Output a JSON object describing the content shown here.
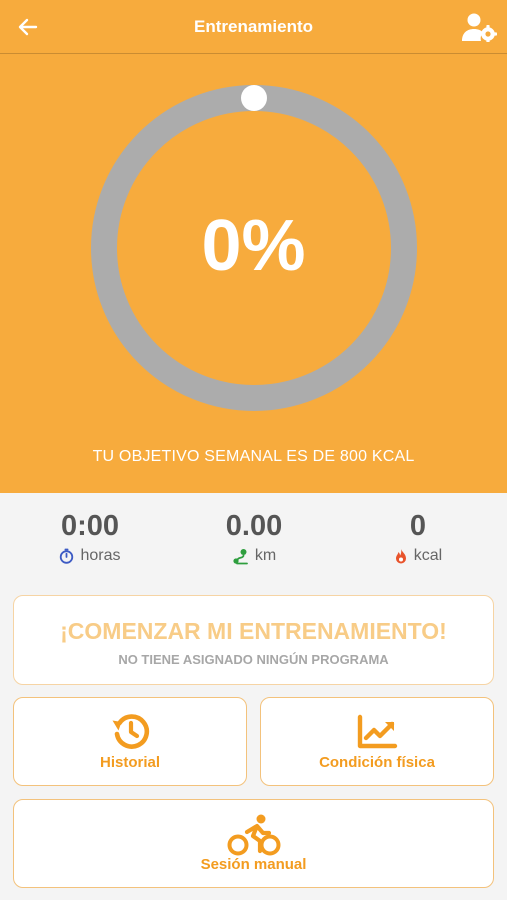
{
  "header": {
    "title": "Entrenamiento",
    "back_icon": "arrow-left-icon",
    "settings_icon": "user-settings-icon"
  },
  "progress": {
    "percent_text": "0%",
    "value": 0,
    "goal_text": "TU OBJETIVO SEMANAL ES DE 800 KCAL"
  },
  "stats": [
    {
      "value": "0:00",
      "label": "horas",
      "icon": "stopwatch-icon",
      "icon_color": "#3d5bc4"
    },
    {
      "value": "0.00",
      "label": "km",
      "icon": "route-icon",
      "icon_color": "#2e9e3e"
    },
    {
      "value": "0",
      "label": "kcal",
      "icon": "flame-icon",
      "icon_color": "#e8532b"
    }
  ],
  "start_card": {
    "title": "¡COMENZAR MI ENTRENAMIENTO!",
    "subtitle": "NO TIENE ASIGNADO NINGÚN PROGRAMA"
  },
  "buttons": {
    "history": "Historial",
    "fitness": "Condición física",
    "manual": "Sesión manual"
  },
  "colors": {
    "primary": "#f7ab3d",
    "accent": "#f39c20",
    "ring_track": "#acacac"
  }
}
